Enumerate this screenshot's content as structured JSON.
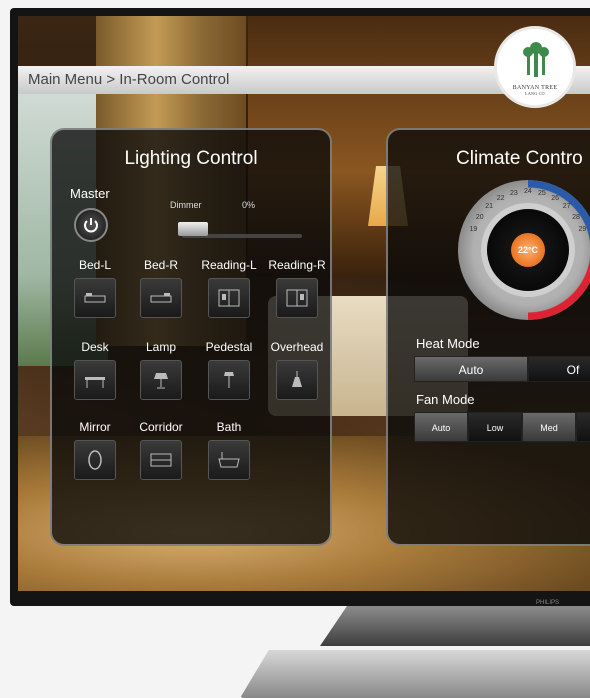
{
  "header": {
    "breadcrumb": "Main Menu > In-Room Control"
  },
  "logo": {
    "line1": "BANYAN TREE",
    "line2": "LANG CO"
  },
  "lighting": {
    "title": "Lighting Control",
    "master_label": "Master",
    "dimmer_label": "Dimmer",
    "dimmer_value": "0%",
    "dimmer_level": 0,
    "rows": [
      [
        {
          "label": "Bed-L",
          "icon": "bed-left-icon"
        },
        {
          "label": "Bed-R",
          "icon": "bed-right-icon"
        },
        {
          "label": "Reading-L",
          "icon": "reading-left-icon"
        },
        {
          "label": "Reading-R",
          "icon": "reading-right-icon"
        }
      ],
      [
        {
          "label": "Desk",
          "icon": "desk-icon"
        },
        {
          "label": "Lamp",
          "icon": "lamp-icon"
        },
        {
          "label": "Pedestal",
          "icon": "pedestal-icon"
        },
        {
          "label": "Overhead",
          "icon": "overhead-icon"
        }
      ],
      [
        {
          "label": "Mirror",
          "icon": "mirror-icon"
        },
        {
          "label": "Corridor",
          "icon": "corridor-icon"
        },
        {
          "label": "Bath",
          "icon": "bath-icon"
        }
      ]
    ]
  },
  "climate": {
    "title": "Climate Contro",
    "temperature": "22°C",
    "dial_ticks": [
      "19",
      "20",
      "21",
      "22",
      "23",
      "24",
      "25",
      "26",
      "27",
      "28",
      "29"
    ],
    "heat_mode_label": "Heat Mode",
    "heat_modes": [
      "Auto",
      "Of"
    ],
    "fan_mode_label": "Fan Mode",
    "fan_modes": [
      "Auto",
      "Low",
      "Med"
    ]
  },
  "tv_brand": "PHILIPS",
  "colors": {
    "accent_orange": "#e05a00",
    "cold_blue": "#2a5aa8",
    "hot_red": "#dd2233"
  }
}
